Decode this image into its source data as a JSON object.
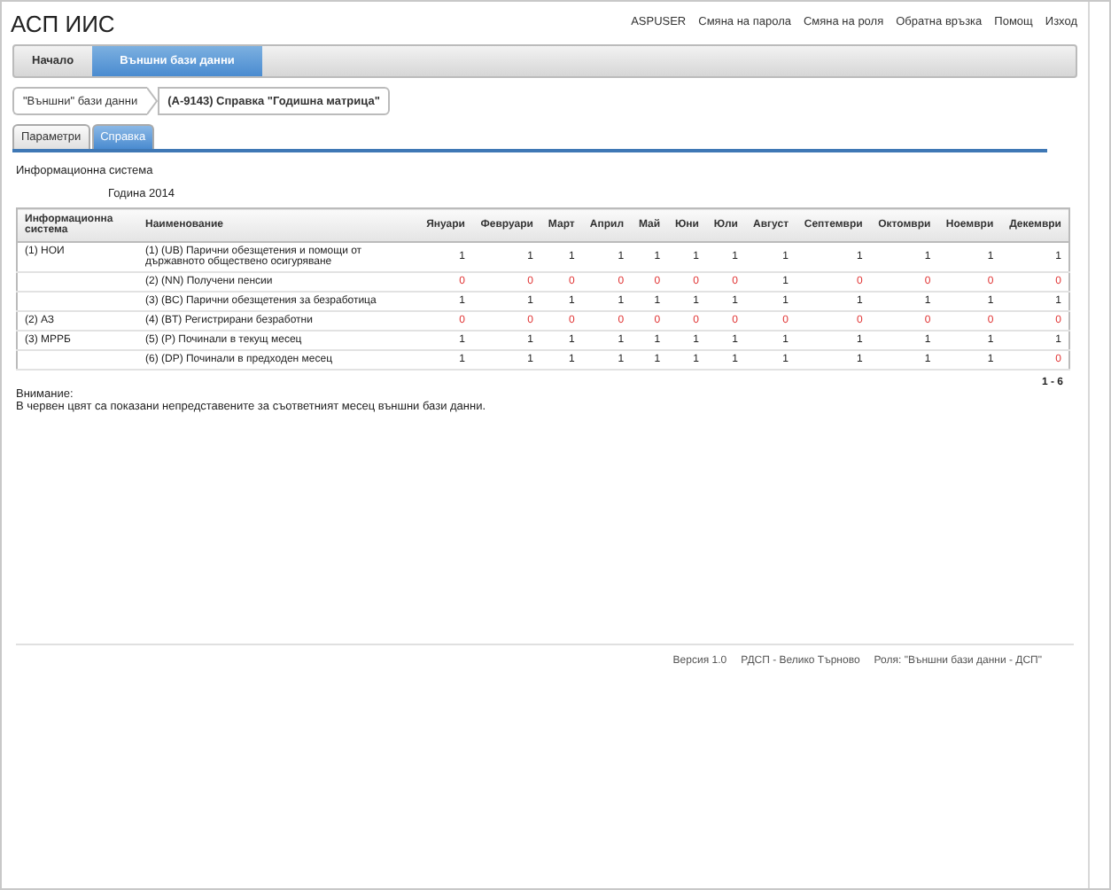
{
  "header": {
    "title": "АСП ИИС",
    "links": [
      "ASPUSER",
      "Смяна на парола",
      "Смяна на роля",
      "Обратна връзка",
      "Помощ",
      "Изход"
    ]
  },
  "nav": [
    {
      "label": "Начало",
      "selected": false
    },
    {
      "label": "Външни бази данни",
      "selected": true
    }
  ],
  "breadcrumbs": [
    "\"Външни\" бази данни",
    "(А-9143) Справка \"Годишна матрица\""
  ],
  "tabs": [
    {
      "label": "Параметри",
      "selected": false
    },
    {
      "label": "Справка",
      "selected": true
    }
  ],
  "report": {
    "caption": "Информационна система",
    "year": "Година 2014",
    "table": {
      "columns": [
        "Информационна система",
        "Наименование",
        "Януари",
        "Февруари",
        "Март",
        "Април",
        "Май",
        "Юни",
        "Юли",
        "Август",
        "Септември",
        "Октомври",
        "Ноември",
        "Декември"
      ],
      "rows": [
        {
          "cells": [
            {
              "text": "(1) НОИ"
            },
            {
              "text": "(1) (UB) Парични обезщетения и помощи от държавното обществено осигуряване"
            },
            {
              "text": "1",
              "missing": false
            },
            {
              "text": "1",
              "missing": false
            },
            {
              "text": "1",
              "missing": false
            },
            {
              "text": "1",
              "missing": false
            },
            {
              "text": "1",
              "missing": false
            },
            {
              "text": "1",
              "missing": false
            },
            {
              "text": "1",
              "missing": false
            },
            {
              "text": "1",
              "missing": false
            },
            {
              "text": "1",
              "missing": false
            },
            {
              "text": "1",
              "missing": false
            },
            {
              "text": "1",
              "missing": false
            },
            {
              "text": "1",
              "missing": false
            }
          ]
        },
        {
          "cells": [
            {
              "text": ""
            },
            {
              "text": "(2) (NN) Получени пенсии"
            },
            {
              "text": "0",
              "missing": true
            },
            {
              "text": "0",
              "missing": true
            },
            {
              "text": "0",
              "missing": true
            },
            {
              "text": "0",
              "missing": true
            },
            {
              "text": "0",
              "missing": true
            },
            {
              "text": "0",
              "missing": true
            },
            {
              "text": "0",
              "missing": true
            },
            {
              "text": "1",
              "missing": false
            },
            {
              "text": "0",
              "missing": true
            },
            {
              "text": "0",
              "missing": true
            },
            {
              "text": "0",
              "missing": true
            },
            {
              "text": "0",
              "missing": true
            }
          ]
        },
        {
          "cells": [
            {
              "text": ""
            },
            {
              "text": "(3) (BC) Парични обезщетения за безработица"
            },
            {
              "text": "1",
              "missing": false
            },
            {
              "text": "1",
              "missing": false
            },
            {
              "text": "1",
              "missing": false
            },
            {
              "text": "1",
              "missing": false
            },
            {
              "text": "1",
              "missing": false
            },
            {
              "text": "1",
              "missing": false
            },
            {
              "text": "1",
              "missing": false
            },
            {
              "text": "1",
              "missing": false
            },
            {
              "text": "1",
              "missing": false
            },
            {
              "text": "1",
              "missing": false
            },
            {
              "text": "1",
              "missing": false
            },
            {
              "text": "1",
              "missing": false
            }
          ]
        },
        {
          "cells": [
            {
              "text": "(2) АЗ"
            },
            {
              "text": "(4) (BT) Регистрирани безработни"
            },
            {
              "text": "0",
              "missing": true
            },
            {
              "text": "0",
              "missing": true
            },
            {
              "text": "0",
              "missing": true
            },
            {
              "text": "0",
              "missing": true
            },
            {
              "text": "0",
              "missing": true
            },
            {
              "text": "0",
              "missing": true
            },
            {
              "text": "0",
              "missing": true
            },
            {
              "text": "0",
              "missing": true
            },
            {
              "text": "0",
              "missing": true
            },
            {
              "text": "0",
              "missing": true
            },
            {
              "text": "0",
              "missing": true
            },
            {
              "text": "0",
              "missing": true
            }
          ]
        },
        {
          "cells": [
            {
              "text": "(3) МРРБ"
            },
            {
              "text": "(5) (P) Починали в текущ месец"
            },
            {
              "text": "1",
              "missing": false
            },
            {
              "text": "1",
              "missing": false
            },
            {
              "text": "1",
              "missing": false
            },
            {
              "text": "1",
              "missing": false
            },
            {
              "text": "1",
              "missing": false
            },
            {
              "text": "1",
              "missing": false
            },
            {
              "text": "1",
              "missing": false
            },
            {
              "text": "1",
              "missing": false
            },
            {
              "text": "1",
              "missing": false
            },
            {
              "text": "1",
              "missing": false
            },
            {
              "text": "1",
              "missing": false
            },
            {
              "text": "1",
              "missing": false
            }
          ]
        },
        {
          "cells": [
            {
              "text": ""
            },
            {
              "text": "(6) (DP) Починали в предходен месец"
            },
            {
              "text": "1",
              "missing": false
            },
            {
              "text": "1",
              "missing": false
            },
            {
              "text": "1",
              "missing": false
            },
            {
              "text": "1",
              "missing": false
            },
            {
              "text": "1",
              "missing": false
            },
            {
              "text": "1",
              "missing": false
            },
            {
              "text": "1",
              "missing": false
            },
            {
              "text": "1",
              "missing": false
            },
            {
              "text": "1",
              "missing": false
            },
            {
              "text": "1",
              "missing": false
            },
            {
              "text": "1",
              "missing": false
            },
            {
              "text": "0",
              "missing": true
            }
          ]
        }
      ]
    },
    "pager": "1 - 6",
    "note_title": "Внимание:",
    "note": "В червен цвят са показани непредставените за съответният месец външни бази данни."
  },
  "footer": [
    "Версия 1.0",
    "РДСП - Велико Търново",
    "Роля: \"Външни бази данни - ДСП\""
  ]
}
